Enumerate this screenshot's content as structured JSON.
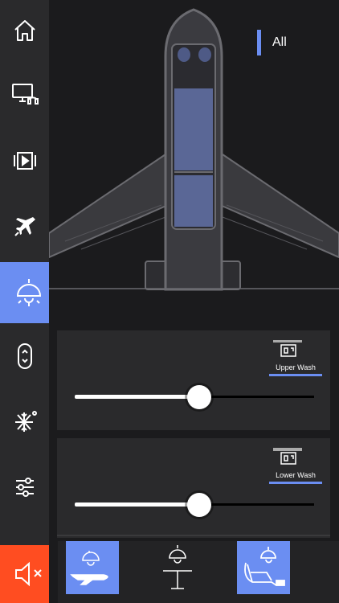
{
  "sidebar": {
    "items": [
      {
        "icon": "home-icon",
        "active": false
      },
      {
        "icon": "monitor-headset-icon",
        "active": false
      },
      {
        "icon": "media-player-icon",
        "active": false
      },
      {
        "icon": "flight-icon",
        "active": false
      },
      {
        "icon": "ceiling-light-icon",
        "active": true
      },
      {
        "icon": "window-shade-icon",
        "active": false
      },
      {
        "icon": "snowflake-icon",
        "active": false
      },
      {
        "icon": "sliders-icon",
        "active": false
      }
    ],
    "mute_icon": "speaker-mute-icon"
  },
  "cabin": {
    "legend_label": "All"
  },
  "controls": [
    {
      "label": "Upper Wash",
      "level": 0.5
    },
    {
      "label": "Lower Wash",
      "level": 0.5
    }
  ],
  "zones": [
    {
      "icon": "aircraft-light-icon",
      "active": true
    },
    {
      "icon": "table-light-icon",
      "active": false
    },
    {
      "icon": "seat-light-icon",
      "active": true
    }
  ],
  "colors": {
    "accent": "#6b8ef2",
    "mute": "#ff4d21",
    "panel": "#2a2a2c",
    "background": "#1b1b1d"
  }
}
